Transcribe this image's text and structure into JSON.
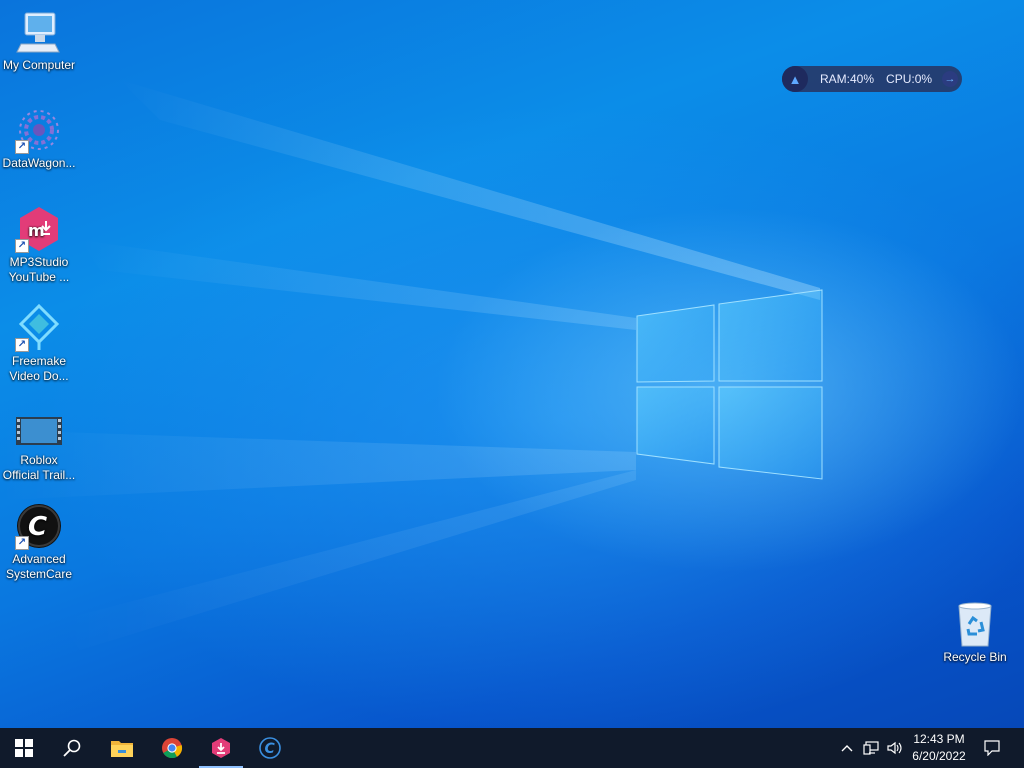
{
  "desktop_icons": [
    {
      "name": "my-computer",
      "label": "My Computer",
      "icon": "computer-icon"
    },
    {
      "name": "datawagon",
      "label": "DataWagon...",
      "icon": "datawagon-icon"
    },
    {
      "name": "mp3studio",
      "label": "MP3Studio\nYouTube ...",
      "icon": "mp3studio-icon"
    },
    {
      "name": "freemake",
      "label": "Freemake\nVideo Do...",
      "icon": "freemake-icon"
    },
    {
      "name": "roblox-trailer",
      "label": "Roblox\nOfficial Trail...",
      "icon": "video-file-icon"
    },
    {
      "name": "advanced-systemcare",
      "label": "Advanced\nSystemCare",
      "icon": "systemcare-icon"
    },
    {
      "name": "recycle-bin",
      "label": "Recycle Bin",
      "icon": "recycle-bin-icon"
    }
  ],
  "widget": {
    "ram": "RAM:40%",
    "cpu": "CPU:0%"
  },
  "taskbar": {
    "items": [
      "start-icon",
      "search-icon",
      "file-explorer-icon",
      "chrome-icon",
      "mp3studio-icon",
      "systemcare-icon"
    ],
    "tray": [
      "chevron-up-icon",
      "network-icon",
      "volume-icon",
      "notification-icon"
    ],
    "time": "12:43 PM",
    "date": "6/20/2022"
  },
  "colors": {
    "taskbar": "#101a2b",
    "accent": "#0a74dc",
    "mp3studio": "#e23c78"
  }
}
